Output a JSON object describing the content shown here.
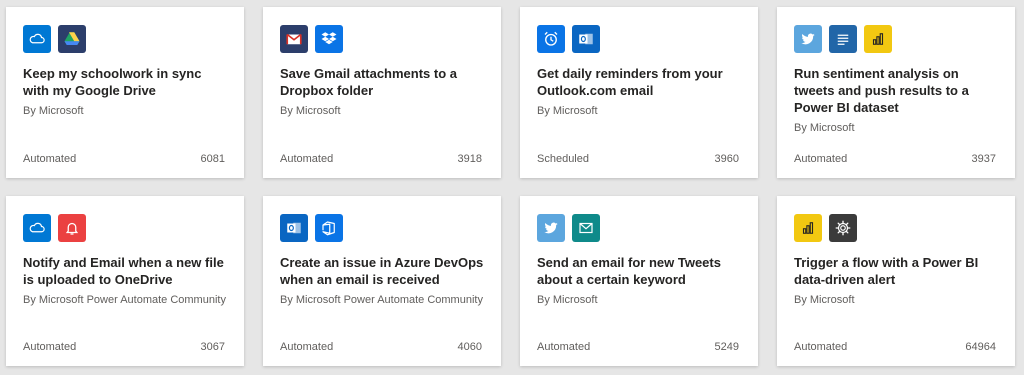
{
  "cards": [
    {
      "title": "Keep my schoolwork in sync with my Google Drive",
      "author": "By Microsoft",
      "type": "Automated",
      "count": "6081",
      "icons": [
        {
          "name": "onedrive-icon",
          "color": "#0078d4"
        },
        {
          "name": "google-drive-icon",
          "color": "#2c3e6b"
        }
      ]
    },
    {
      "title": "Save Gmail attachments to a Dropbox folder",
      "author": "By Microsoft",
      "type": "Automated",
      "count": "3918",
      "icons": [
        {
          "name": "gmail-icon",
          "color": "#2c3e6b"
        },
        {
          "name": "dropbox-icon",
          "color": "#0a74e6"
        }
      ]
    },
    {
      "title": "Get daily reminders from your Outlook.com email",
      "author": "By Microsoft",
      "type": "Scheduled",
      "count": "3960",
      "icons": [
        {
          "name": "alarm-clock-icon",
          "color": "#0a74e6"
        },
        {
          "name": "outlook-icon",
          "color": "#0a66c2"
        }
      ]
    },
    {
      "title": "Run sentiment analysis on tweets and push results to a Power BI dataset",
      "author": "By Microsoft",
      "type": "Automated",
      "count": "3937",
      "icons": [
        {
          "name": "twitter-icon",
          "color": "#5ca6de"
        },
        {
          "name": "text-analytics-icon",
          "color": "#2266a8"
        },
        {
          "name": "power-bi-icon",
          "color": "#f2c811"
        }
      ]
    },
    {
      "title": "Notify and Email when a new file is uploaded to OneDrive",
      "author": "By Microsoft Power Automate Community",
      "type": "Automated",
      "count": "3067",
      "icons": [
        {
          "name": "onedrive-icon",
          "color": "#0078d4"
        },
        {
          "name": "notification-bell-icon",
          "color": "#eb4141"
        }
      ]
    },
    {
      "title": "Create an issue in Azure DevOps when an email is received",
      "author": "By Microsoft Power Automate Community",
      "type": "Automated",
      "count": "4060",
      "icons": [
        {
          "name": "outlook-icon",
          "color": "#0a66c2"
        },
        {
          "name": "azure-devops-icon",
          "color": "#0a74e6"
        }
      ]
    },
    {
      "title": "Send an email for new Tweets about a certain keyword",
      "author": "By Microsoft",
      "type": "Automated",
      "count": "5249",
      "icons": [
        {
          "name": "twitter-icon",
          "color": "#5ca6de"
        },
        {
          "name": "mail-icon",
          "color": "#0f8a8a"
        }
      ]
    },
    {
      "title": "Trigger a flow with a Power BI data-driven alert",
      "author": "By Microsoft",
      "type": "Automated",
      "count": "64964",
      "icons": [
        {
          "name": "power-bi-icon",
          "color": "#f2c811"
        },
        {
          "name": "gear-icon",
          "color": "#3b3b3b"
        }
      ]
    }
  ]
}
